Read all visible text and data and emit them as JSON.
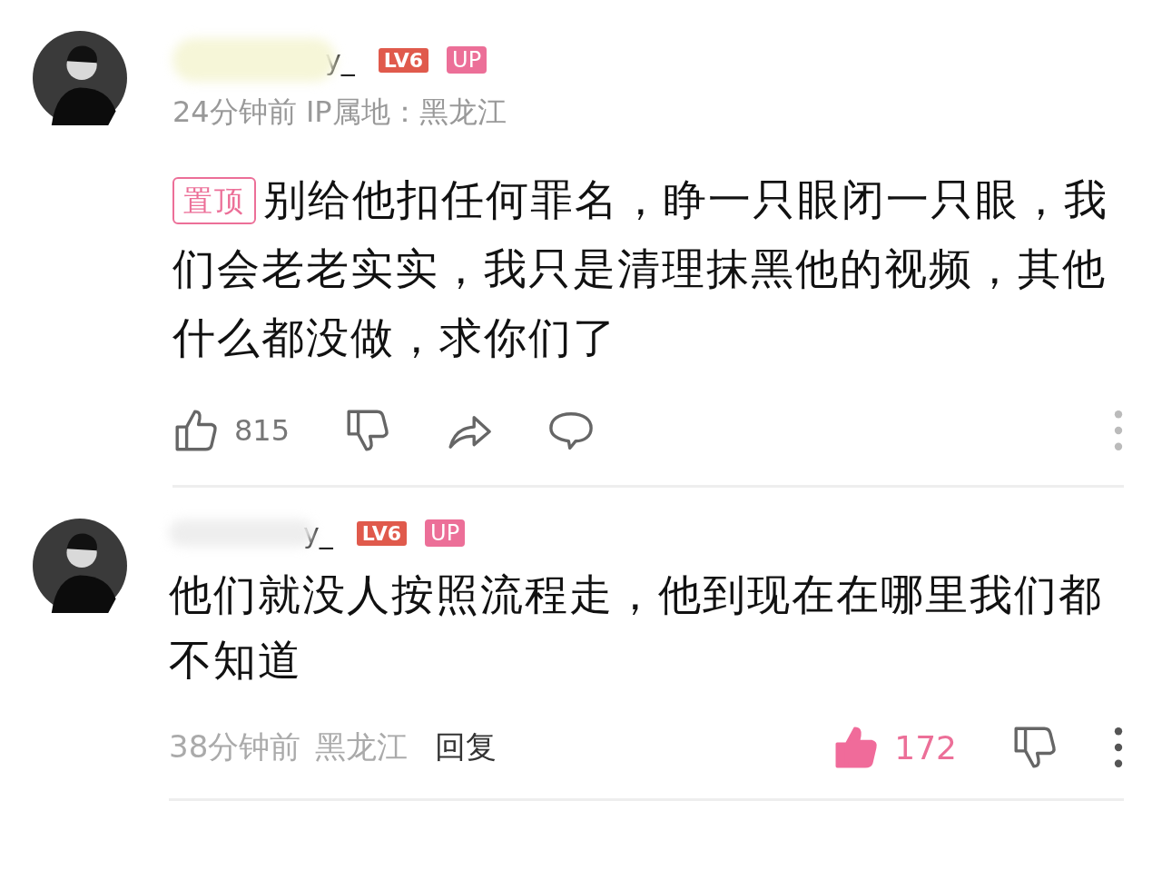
{
  "comments": [
    {
      "username": "y_",
      "level_badge": "LV6",
      "up_badge": "UP",
      "meta": "24分钟前 IP属地：黑龙江",
      "pinned_label": "置顶",
      "text": "别给他扣任何罪名，睁一只眼闭一只眼，我们会老老实实，我只是清理抹黑他的视频，其他什么都没做，求你们了",
      "kind": "full",
      "likes": "815",
      "liked": false
    },
    {
      "username": "y_",
      "level_badge": "LV6",
      "up_badge": "UP",
      "time": "38分钟前",
      "location": "黑龙江",
      "reply_label": "回复",
      "text": "他们就没人按照流程走，他到现在在哪里我们都不知道",
      "kind": "compact",
      "likes": "172",
      "liked": true
    }
  ]
}
